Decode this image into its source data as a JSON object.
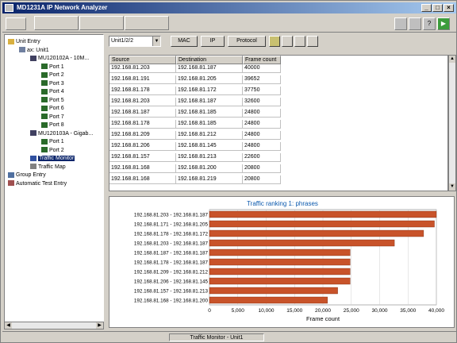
{
  "window": {
    "title": "MD1231A IP Network Analyzer",
    "controls": [
      "_",
      "□",
      "×"
    ]
  },
  "tree": {
    "items": [
      {
        "label": "Unit Entry",
        "icon": "folder-icon",
        "depth": 0
      },
      {
        "label": "ax: Unit1",
        "icon": "unit-icon",
        "depth": 1
      },
      {
        "label": "MU120102A - 10M...",
        "icon": "module-icon",
        "depth": 2
      },
      {
        "label": "Port 1",
        "icon": "port-icon",
        "depth": 3
      },
      {
        "label": "Port 2",
        "icon": "port-icon",
        "depth": 3
      },
      {
        "label": "Port 3",
        "icon": "port-icon",
        "depth": 3
      },
      {
        "label": "Port 4",
        "icon": "port-icon",
        "depth": 3
      },
      {
        "label": "Port 5",
        "icon": "port-icon",
        "depth": 3
      },
      {
        "label": "Port 6",
        "icon": "port-icon",
        "depth": 3
      },
      {
        "label": "Port 7",
        "icon": "port-icon",
        "depth": 3
      },
      {
        "label": "Port 8",
        "icon": "port-icon",
        "depth": 3
      },
      {
        "label": "MU120103A - Gigab...",
        "icon": "module-icon",
        "depth": 2
      },
      {
        "label": "Port 1",
        "icon": "port-icon",
        "depth": 3
      },
      {
        "label": "Port 2",
        "icon": "port-icon",
        "depth": 3
      },
      {
        "label": "Traffic Monitor",
        "icon": "monitor-icon",
        "depth": 2,
        "selected": true
      },
      {
        "label": "Traffic Map",
        "icon": "map-icon",
        "depth": 2
      },
      {
        "label": "Group Entry",
        "icon": "group-icon",
        "depth": 0
      },
      {
        "label": "Automatic Test Entry",
        "icon": "test-icon",
        "depth": 0
      }
    ]
  },
  "filter": {
    "select_value": "Unit1/2/2",
    "buttons": [
      "MAC",
      "IP",
      "Protocol"
    ]
  },
  "table": {
    "headers": [
      "Source",
      "Destination",
      "Frame count"
    ],
    "rows": [
      [
        "192.168.81.203",
        "192.168.81.187",
        "40000"
      ],
      [
        "192.168.81.191",
        "192.168.81.205",
        "39652"
      ],
      [
        "192.168.81.178",
        "192.168.81.172",
        "37750"
      ],
      [
        "192.168.81.203",
        "192.168.81.187",
        "32600"
      ],
      [
        "192.168.81.187",
        "192.168.81.185",
        "24800"
      ],
      [
        "192.168.81.178",
        "192.168.81.185",
        "24800"
      ],
      [
        "192.168.81.209",
        "192.168.81.212",
        "24800"
      ],
      [
        "192.168.81.206",
        "192.168.81.145",
        "24800"
      ],
      [
        "192.168.81.157",
        "192.168.81.213",
        "22600"
      ],
      [
        "192.168.81.168",
        "192.168.81.200",
        "20800"
      ],
      [
        "192.168.81.168",
        "192.168.81.219",
        "20800"
      ]
    ]
  },
  "chart_data": {
    "type": "bar",
    "orientation": "horizontal",
    "title": "Traffic ranking 1: phrases",
    "xlabel": "Frame count",
    "xlim": [
      0,
      40000
    ],
    "xticks": [
      "0",
      "5,000",
      "10,000",
      "15,000",
      "20,000",
      "25,000",
      "30,000",
      "35,000",
      "40,000"
    ],
    "categories": [
      "192.168.81.203 - 192.168.81.187",
      "192.168.81.171 - 192.168.81.205",
      "192.168.81.178 - 192.168.81.172",
      "192.168.81.203 - 192.168.81.187",
      "192.168.81.187 - 192.168.81.187",
      "192.168.81.178 - 192.168.81.187",
      "192.168.81.209 - 192.168.81.212",
      "192.168.81.206 - 192.168.81.145",
      "192.168.81.157 - 192.168.81.213",
      "192.168.81.168 - 192.168.81.200"
    ],
    "values": [
      40000,
      39652,
      37750,
      32600,
      24800,
      24800,
      24800,
      24800,
      22600,
      20800
    ],
    "bar_color": "#c8532a",
    "grid": true
  },
  "status": {
    "text": "Traffic Monitor - Unit1"
  }
}
